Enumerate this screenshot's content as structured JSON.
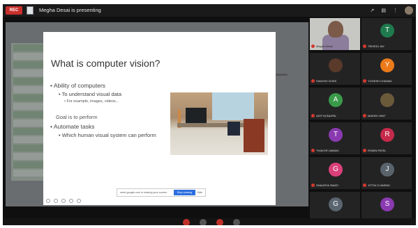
{
  "topbar": {
    "rec_label": "REC",
    "presenting_text": "Megha Desai is presenting",
    "view_label": "↗",
    "chat_label": "▤",
    "menu_label": "⋮"
  },
  "slide": {
    "title": "What is computer vision?",
    "bullets": [
      "• Ability of computers",
      "• To understand visual data",
      "• For example, images, videos...",
      "Goal is to perform",
      "• Automate tasks",
      "• Which human visual system can perform"
    ]
  },
  "share_toolbar": {
    "message": "meet.google.com is sharing your screen",
    "stop_label": "Stop sharing",
    "hide_label": "Hide"
  },
  "participants": [
    {
      "name": "Megha Desai",
      "initial": "",
      "color": "#8b7d9b",
      "kind": "video"
    },
    {
      "name": "TRIVEDI JAY",
      "initial": "T",
      "color": "#1f7a4d",
      "kind": "initial"
    },
    {
      "name": "SINGHVI VIVEK",
      "initial": "",
      "color": "#5a3a2a",
      "kind": "photo"
    },
    {
      "name": "YOGESH CHAVAN",
      "initial": "Y",
      "color": "#ec7a1a",
      "kind": "initial"
    },
    {
      "name": "ADITYA BAJPAI",
      "initial": "A",
      "color": "#3a9a4a",
      "kind": "initial"
    },
    {
      "name": "MAKEN VINIT",
      "initial": "",
      "color": "#6b5a3a",
      "kind": "photo"
    },
    {
      "name": "THAKOR UMANG",
      "initial": "T",
      "color": "#8a3ab0",
      "kind": "initial"
    },
    {
      "name": "ROMIN PATEL",
      "initial": "R",
      "color": "#c52a4a",
      "kind": "initial"
    },
    {
      "name": "SHAURYA SWATI",
      "initial": "G",
      "color": "#d9407a",
      "kind": "initial"
    },
    {
      "name": "JITTIN S HARDIK",
      "initial": "J",
      "color": "#59636b",
      "kind": "initial"
    },
    {
      "name": "GAUSHAAR MITESH",
      "initial": "G",
      "color": "#5a6570",
      "kind": "initial"
    },
    {
      "name": "SALIL REDAR",
      "initial": "S",
      "color": "#8a3ab0",
      "kind": "initial"
    }
  ]
}
